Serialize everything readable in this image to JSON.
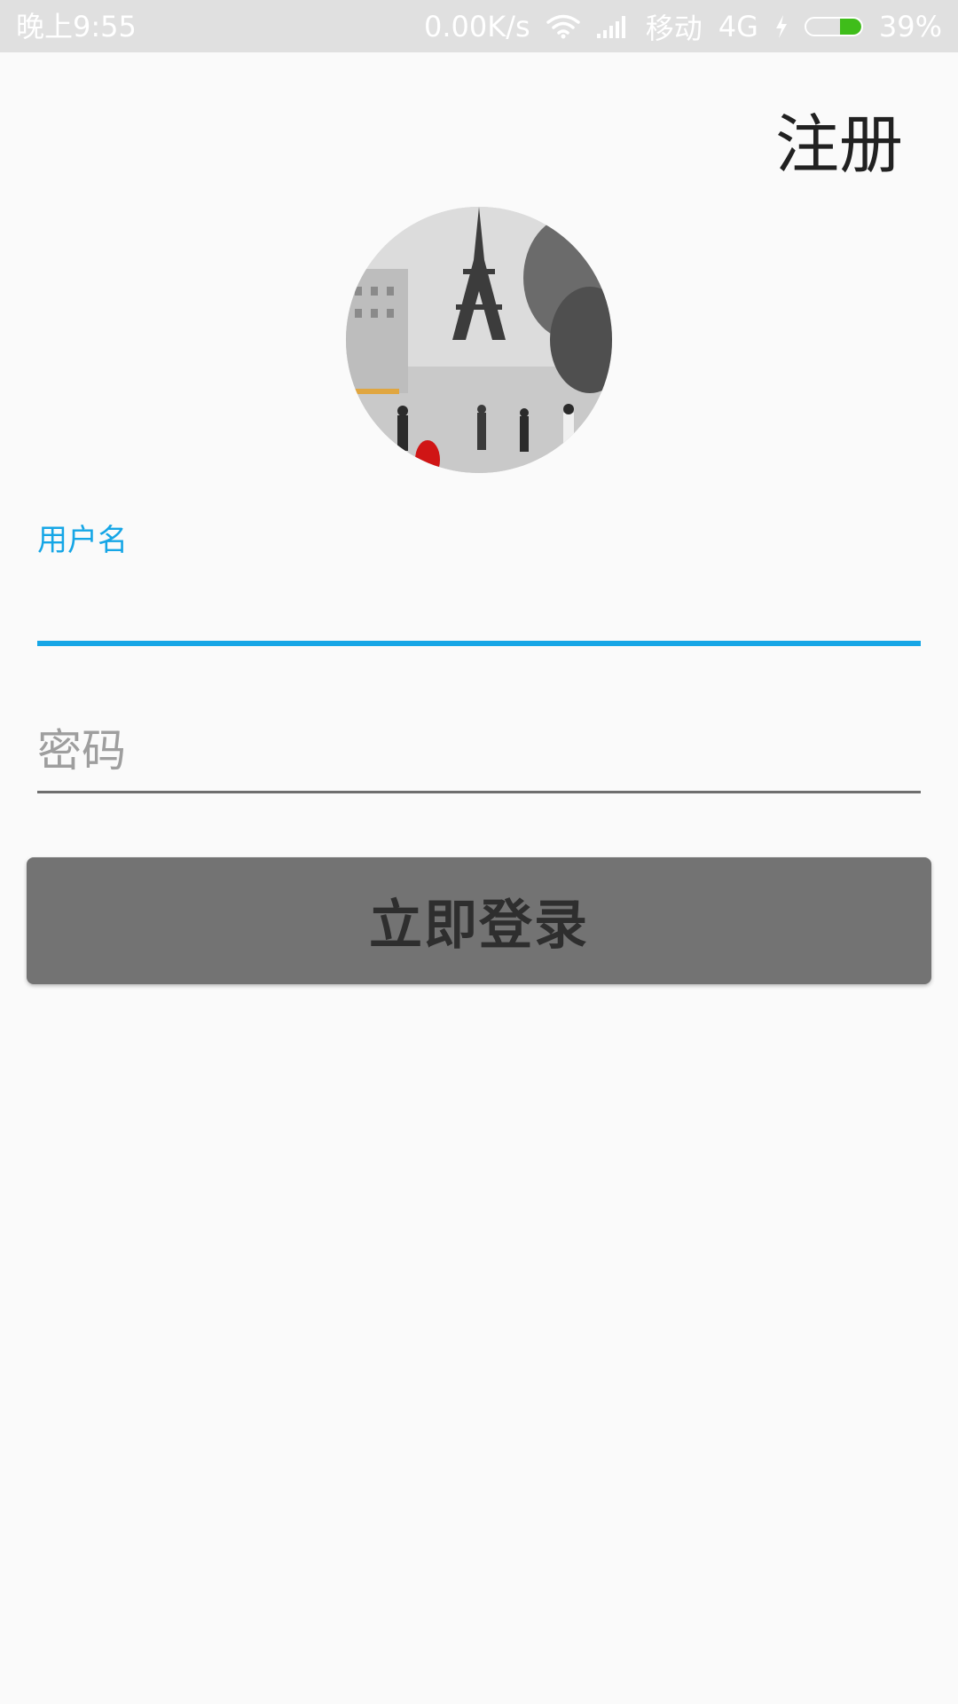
{
  "status_bar": {
    "time": "晚上9:55",
    "network_speed": "0.00K/s",
    "carrier": "移动",
    "network_type": "4G",
    "battery_percent": "39%",
    "battery_level": 0.39,
    "icons": [
      "wifi-icon",
      "signal-icon",
      "charging-icon",
      "battery-icon"
    ]
  },
  "header": {
    "register_label": "注册"
  },
  "avatar": {
    "icon": "avatar-image"
  },
  "form": {
    "username_label": "用户名",
    "username_value": "",
    "password_placeholder": "密码",
    "password_value": ""
  },
  "actions": {
    "login_label": "立即登录"
  },
  "colors": {
    "accent": "#16a6e6",
    "status_bar_bg": "#e0e0e0",
    "button_bg": "#737373",
    "button_text": "#2e2e2e",
    "battery_fill": "#3fbd1a",
    "page_bg": "#fafafa"
  }
}
